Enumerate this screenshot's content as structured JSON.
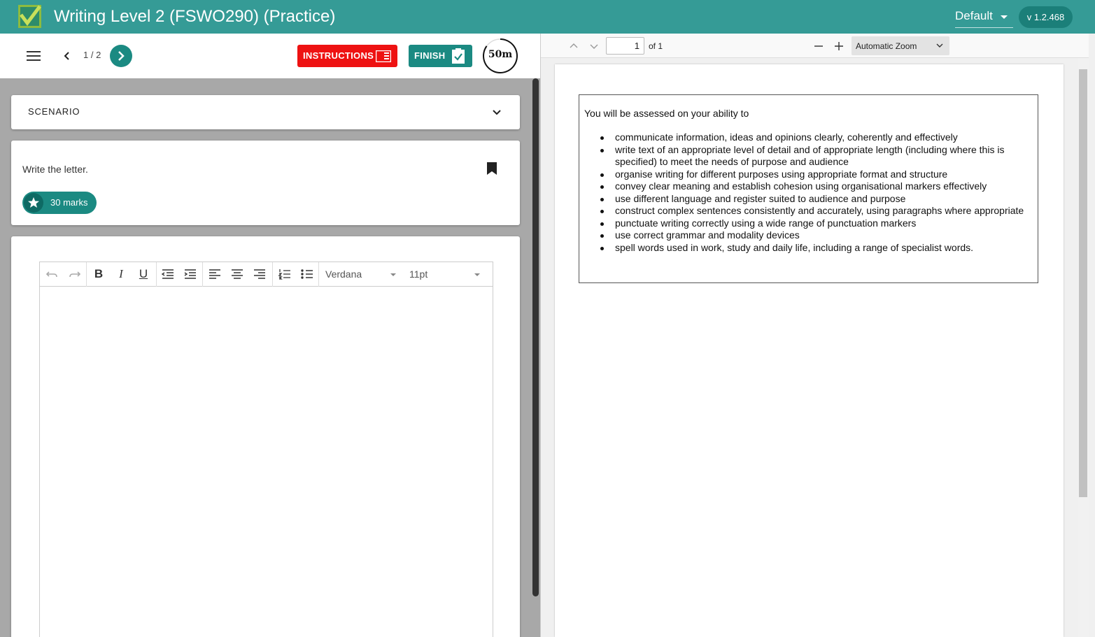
{
  "app": {
    "title": "Writing Level 2 (FSWO290) (Practice)",
    "theme": "Default",
    "version": "v 1.2.468",
    "brand_color": "#359b96",
    "accent_color": "#1b8a82"
  },
  "toolbar": {
    "page_count": "1 / 2",
    "instructions_label": "INSTRUCTIONS",
    "finish_label": "FINISH",
    "timer": "50m",
    "timer_fraction_remaining": 0.85
  },
  "scenario": {
    "title": "SCENARIO"
  },
  "question": {
    "prompt": "Write the letter.",
    "marks": "30 marks"
  },
  "editor": {
    "font": "Verdana",
    "size": "11pt",
    "content": ""
  },
  "pdf": {
    "page_value": "1",
    "page_of": "of 1",
    "zoom": "Automatic Zoom",
    "intro": "You will be assessed on your ability to",
    "items": [
      "communicate information, ideas and opinions clearly, coherently and effectively",
      "write text of an appropriate level of detail and of appropriate length (including where this is specified) to meet the needs of purpose and audience",
      "organise writing for different purposes using appropriate format and structure",
      "convey clear meaning and establish cohesion using organisational markers effectively",
      "use different language and register suited to audience and purpose",
      "construct complex sentences consistently and accurately, using paragraphs where appropriate",
      "punctuate writing correctly using a wide range of punctuation markers",
      "use correct grammar and modality devices",
      "spell words used in work, study and daily life, including a range of specialist words."
    ]
  }
}
